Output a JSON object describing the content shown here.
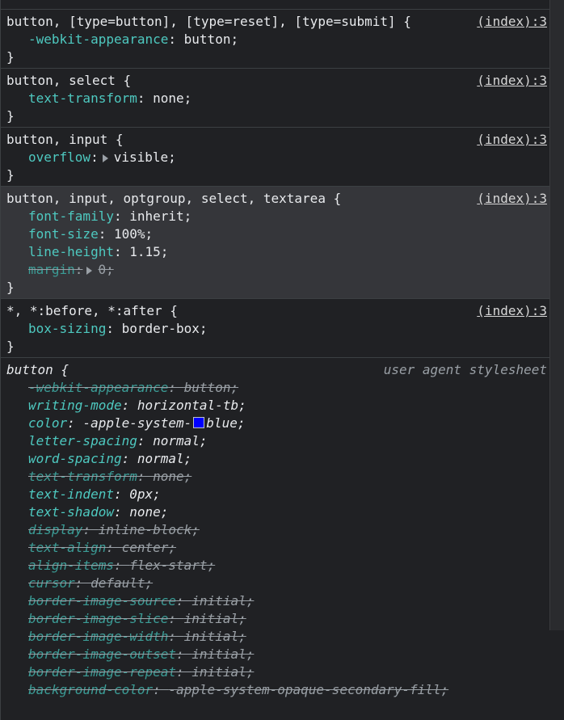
{
  "rules": [
    {
      "selector": "button, [type=button], [type=reset], [type=submit] {",
      "source": "(index):3",
      "declarations": [
        {
          "prop": "-webkit-appearance",
          "value": "button;",
          "struck": false
        }
      ]
    },
    {
      "selector": "button, select {",
      "source": "(index):3",
      "declarations": [
        {
          "prop": "text-transform",
          "value": "none;",
          "struck": false
        }
      ]
    },
    {
      "selector": "button, input {",
      "source": "(index):3",
      "declarations": [
        {
          "prop": "overflow",
          "value": "visible;",
          "struck": false,
          "expandable": true
        }
      ]
    },
    {
      "selector": "button, input, optgroup, select, textarea {",
      "source": "(index):3",
      "declarations": [
        {
          "prop": "font-family",
          "value": "inherit;",
          "struck": false
        },
        {
          "prop": "font-size",
          "value": "100%;",
          "struck": false
        },
        {
          "prop": "line-height",
          "value": "1.15;",
          "struck": false
        },
        {
          "prop": "margin",
          "value": "0;",
          "struck": true,
          "expandable": true
        }
      ]
    },
    {
      "selector": "*, *:before, *:after {",
      "source": "(index):3",
      "declarations": [
        {
          "prop": "box-sizing",
          "value": "border-box;",
          "struck": false
        }
      ]
    }
  ],
  "ua_rule": {
    "selector": "button {",
    "source": "user agent stylesheet",
    "declarations": [
      {
        "prop": "-webkit-appearance",
        "value": "button;",
        "struck": true
      },
      {
        "prop": "writing-mode",
        "value": "horizontal-tb;",
        "struck": false
      },
      {
        "prop": "color",
        "value_pre": "-apple-system-",
        "value_post": "blue;",
        "swatch_color": "#0000ff",
        "struck": false
      },
      {
        "prop": "letter-spacing",
        "value": "normal;",
        "struck": false
      },
      {
        "prop": "word-spacing",
        "value": "normal;",
        "struck": false
      },
      {
        "prop": "text-transform",
        "value": "none;",
        "struck": true
      },
      {
        "prop": "text-indent",
        "value": "0px;",
        "struck": false
      },
      {
        "prop": "text-shadow",
        "value": "none;",
        "struck": false
      },
      {
        "prop": "display",
        "value": "inline-block;",
        "struck": true
      },
      {
        "prop": "text-align",
        "value": "center;",
        "struck": true
      },
      {
        "prop": "align-items",
        "value": "flex-start;",
        "struck": true
      },
      {
        "prop": "cursor",
        "value": "default;",
        "struck": true
      },
      {
        "prop": "border-image-source",
        "value": "initial;",
        "struck": true
      },
      {
        "prop": "border-image-slice",
        "value": "initial;",
        "struck": true
      },
      {
        "prop": "border-image-width",
        "value": "initial;",
        "struck": true
      },
      {
        "prop": "border-image-outset",
        "value": "initial;",
        "struck": true
      },
      {
        "prop": "border-image-repeat",
        "value": "initial;",
        "struck": true
      },
      {
        "prop": "background-color",
        "value": "-apple-system-opaque-secondary-fill;",
        "struck": true
      }
    ]
  },
  "closing_brace": "}",
  "colors": {
    "background": "#202124",
    "property": "#4ec9c0",
    "swatch_blue": "#0000ff"
  }
}
